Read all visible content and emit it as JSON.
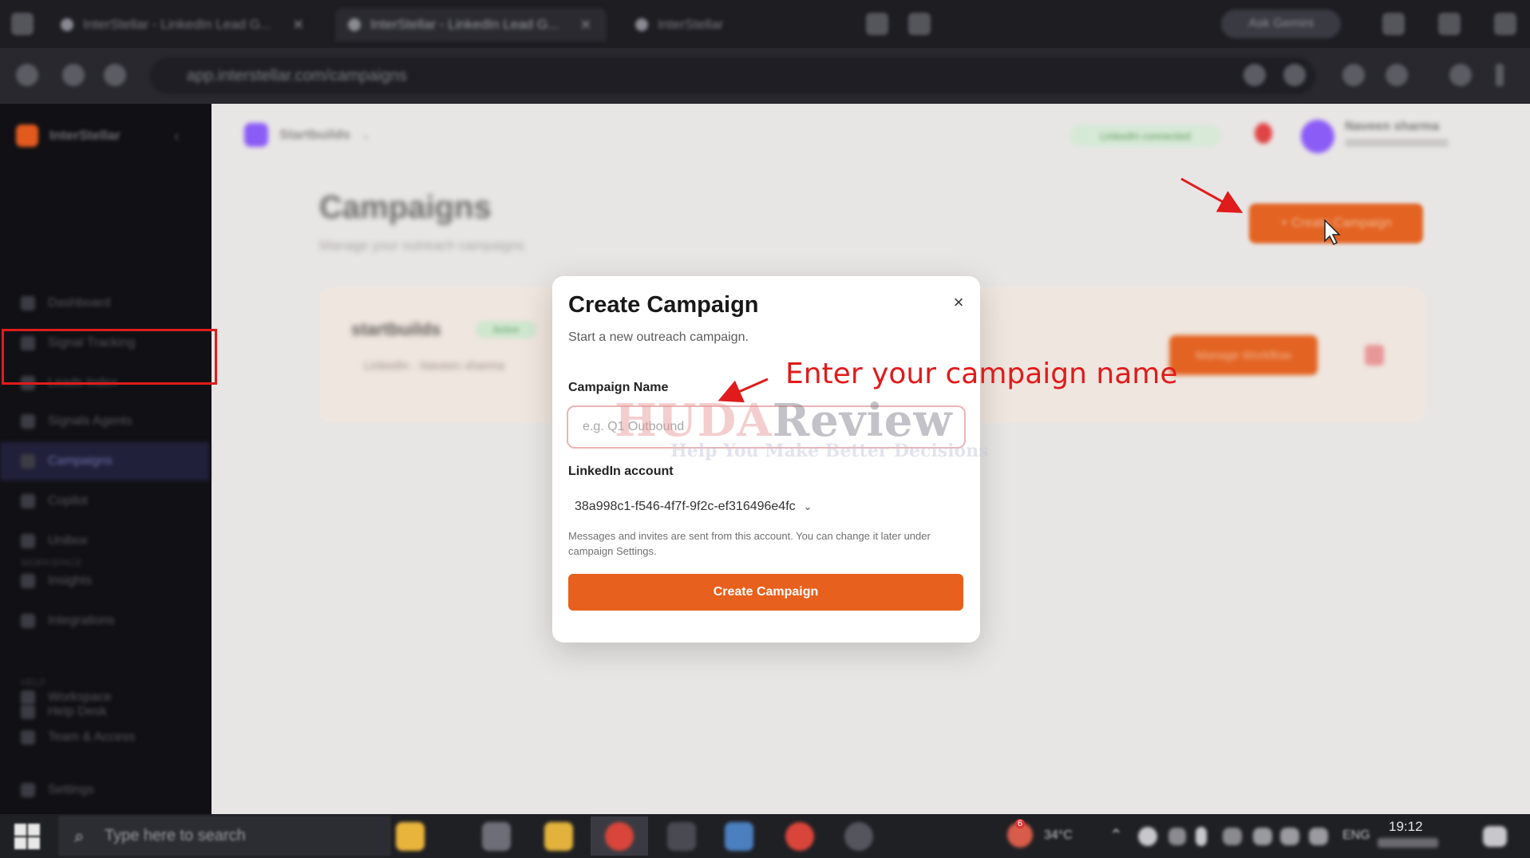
{
  "browser": {
    "tabs": [
      {
        "label": "InterStellar - LinkedIn Lead G..."
      },
      {
        "label": "InterStellar - LinkedIn Lead G..."
      },
      {
        "label": "InterStellar"
      }
    ],
    "gemini_label": "Ask Gemini",
    "url": "app.interstellar.com/campaigns"
  },
  "sidebar": {
    "brand": "InterStellar",
    "items": [
      {
        "label": "Dashboard",
        "icon": "grid-icon"
      },
      {
        "label": "Signal Tracking",
        "icon": "radar-icon"
      },
      {
        "label": "Leads Index",
        "icon": "list-icon"
      },
      {
        "label": "Signals Agents",
        "icon": "agent-icon"
      },
      {
        "label": "Campaigns",
        "icon": "send-icon"
      },
      {
        "label": "Copilot",
        "icon": "spark-icon"
      },
      {
        "label": "Unibox",
        "icon": "inbox-icon"
      },
      {
        "label": "Insights",
        "icon": "chart-icon"
      },
      {
        "label": "Integrations",
        "icon": "plug-icon"
      }
    ],
    "section_workspace": "WORKSPACE",
    "workspace_items": [
      {
        "label": "Workspace",
        "icon": "building-icon"
      },
      {
        "label": "Team & Access",
        "icon": "users-icon"
      }
    ],
    "section_help": "HELP",
    "help_items": [
      {
        "label": "Help Desk",
        "icon": "help-icon"
      }
    ],
    "settings_label": "Settings"
  },
  "header": {
    "workspace_name": "Startbuilds",
    "status": "LinkedIn connected",
    "user_name": "Naveen sharma"
  },
  "page": {
    "title": "Campaigns",
    "subtitle": "Manage your outreach campaigns",
    "new_campaign_label": "+ Create Campaign"
  },
  "campaign_card": {
    "name": "startbuilds",
    "status": "Active",
    "meta": "LinkedIn · Naveen sharma",
    "manage_label": "Manage Workflow"
  },
  "modal": {
    "title": "Create Campaign",
    "subtitle": "Start a new outreach campaign.",
    "close_glyph": "×",
    "name_label": "Campaign Name",
    "name_placeholder": "e.g. Q1 Outbound",
    "name_value": "",
    "account_label": "LinkedIn account",
    "account_value": "38a998c1-f546-4f7f-9f2c-ef316496e4fc",
    "help_text": "Messages and invites are sent from this account. You can change it later under campaign Settings.",
    "submit_label": "Create Campaign"
  },
  "annotation": {
    "text": "Enter your campaign name",
    "color": "#e01b1b"
  },
  "watermark": {
    "part1": "HUDA",
    "part2": "Review",
    "tagline": "Help You Make Better Decisions"
  },
  "taskbar": {
    "search_placeholder": "Type here to search",
    "temperature": "34°C",
    "language": "ENG",
    "time": "19:12",
    "notification_count": "6"
  },
  "colors": {
    "accent": "#e8601d",
    "sidebar_bg": "#111115",
    "page_bg": "#e8e6e5"
  }
}
